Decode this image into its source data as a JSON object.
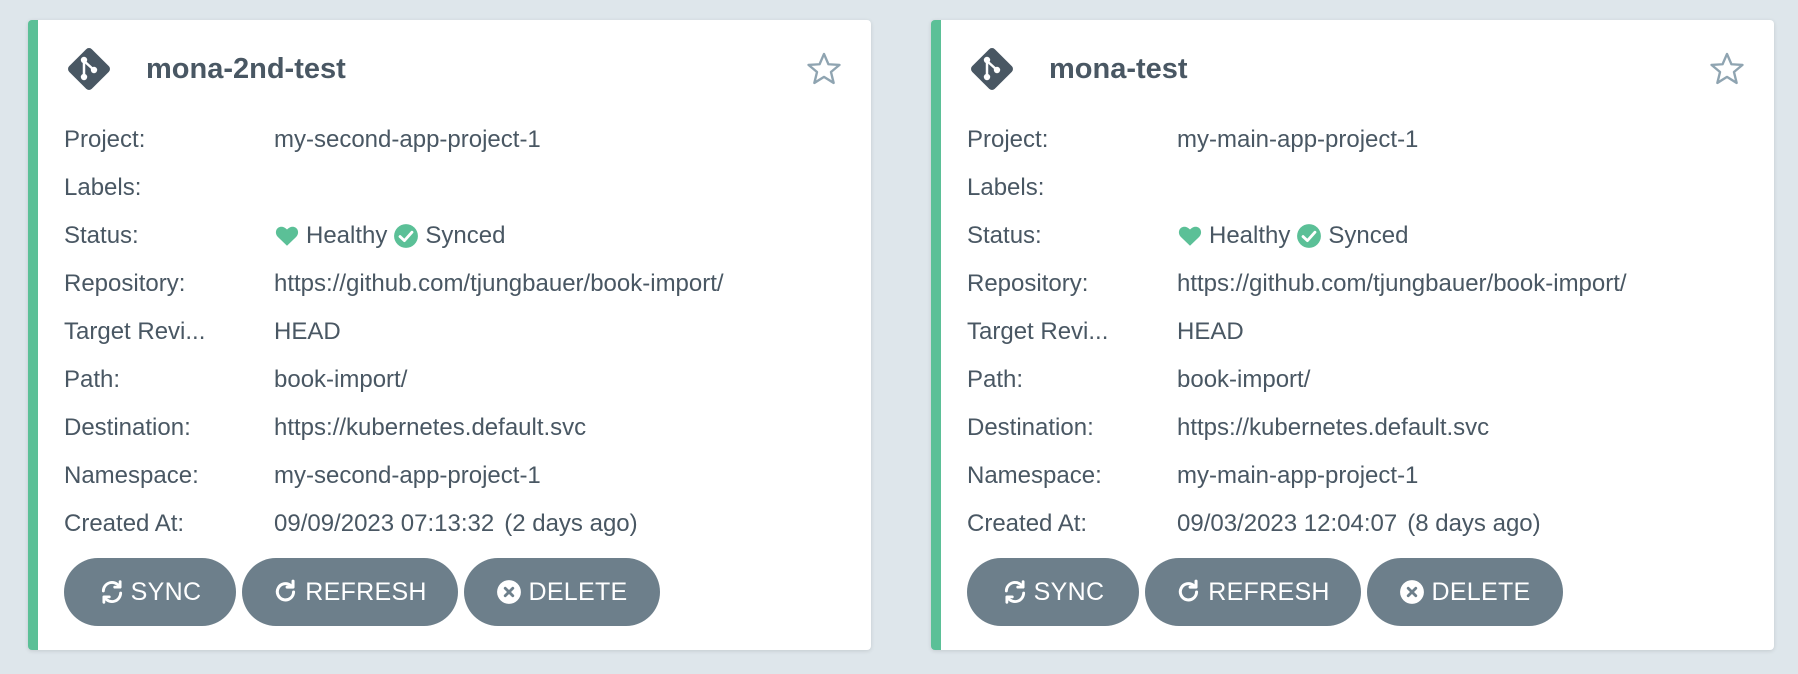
{
  "colors": {
    "accent": "#5bc097",
    "button_bg": "#6d7f8b",
    "page_bg": "#dee6eb",
    "text": "#495763",
    "star": "#8fa4b1"
  },
  "labels": {
    "project": "Project:",
    "labels": "Labels:",
    "status": "Status:",
    "repository": "Repository:",
    "target_revision": "Target Revi...",
    "path": "Path:",
    "destination": "Destination:",
    "namespace": "Namespace:",
    "created_at": "Created At:"
  },
  "buttons": {
    "sync": "SYNC",
    "refresh": "REFRESH",
    "delete": "DELETE"
  },
  "apps": [
    {
      "name": "mona-2nd-test",
      "icon": "git-icon",
      "project": "my-second-app-project-1",
      "labels": "",
      "health": "Healthy",
      "sync": "Synced",
      "repository": "https://github.com/tjungbauer/book-import/",
      "target_revision": "HEAD",
      "path": "book-import/",
      "destination": "https://kubernetes.default.svc",
      "namespace": "my-second-app-project-1",
      "created_at": "09/09/2023 07:13:32",
      "created_ago": "(2 days ago)"
    },
    {
      "name": "mona-test",
      "icon": "git-icon",
      "project": "my-main-app-project-1",
      "labels": "",
      "health": "Healthy",
      "sync": "Synced",
      "repository": "https://github.com/tjungbauer/book-import/",
      "target_revision": "HEAD",
      "path": "book-import/",
      "destination": "https://kubernetes.default.svc",
      "namespace": "my-main-app-project-1",
      "created_at": "09/03/2023 12:04:07",
      "created_ago": "(8 days ago)"
    }
  ]
}
